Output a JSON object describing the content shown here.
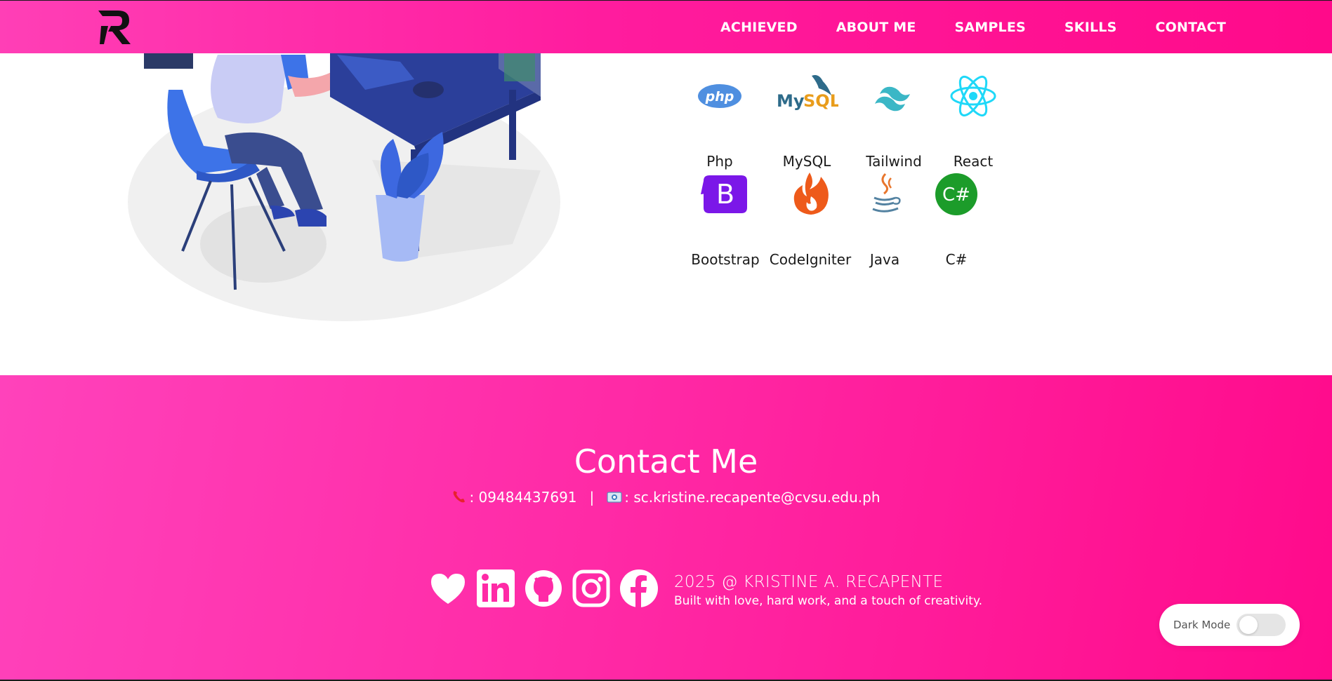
{
  "nav": {
    "logo_alt": "R",
    "links": [
      "ACHIEVED",
      "ABOUT ME",
      "SAMPLES",
      "SKILLS",
      "CONTACT"
    ]
  },
  "skills": [
    {
      "label": "Php",
      "icon": "php-icon"
    },
    {
      "label": "MySQL",
      "icon": "mysql-icon"
    },
    {
      "label": "Tailwind",
      "icon": "tailwind-icon"
    },
    {
      "label": "React",
      "icon": "react-icon"
    },
    {
      "label": "Bootstrap",
      "icon": "bootstrap-icon"
    },
    {
      "label": "CodeIgniter",
      "icon": "codeigniter-icon"
    },
    {
      "label": "Java",
      "icon": "java-icon"
    },
    {
      "label": "C#",
      "icon": "csharp-icon"
    }
  ],
  "contact": {
    "title": "Contact Me",
    "phone_prefix": ": ",
    "phone": "09484437691",
    "separator": "|",
    "email_prefix": ": ",
    "email": "sc.kristine.recapente@cvsu.edu.ph"
  },
  "footer": {
    "copyright": "2025 @ KRISTINE A. RECAPENTE",
    "tagline": "Built with love, hard work, and a touch of creativity.",
    "socials": [
      "heart-icon",
      "linkedin-icon",
      "github-icon",
      "instagram-icon",
      "facebook-icon"
    ]
  },
  "dark_mode": {
    "label": "Dark Mode",
    "enabled": false
  },
  "colors": {
    "accent_pink": "#ff1c9e",
    "nav_text": "#ffffff"
  }
}
